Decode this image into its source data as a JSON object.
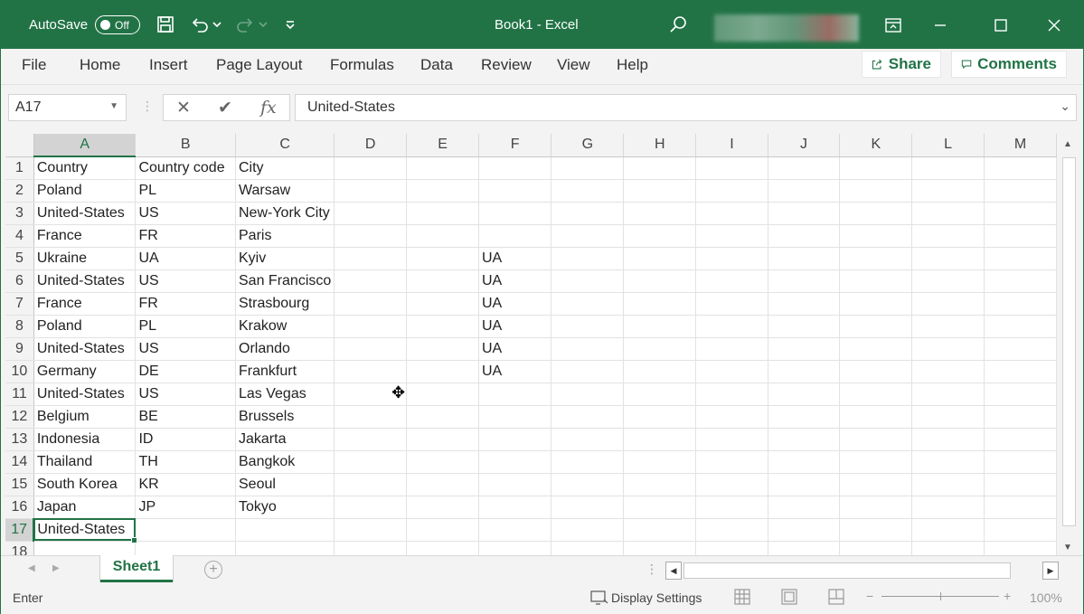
{
  "titlebar": {
    "autosave_label": "AutoSave",
    "autosave_state": "Off",
    "document_title": "Book1  -  Excel"
  },
  "ribbon": {
    "tabs": [
      "File",
      "Home",
      "Insert",
      "Page Layout",
      "Formulas",
      "Data",
      "Review",
      "View",
      "Help"
    ],
    "share_label": "Share",
    "comments_label": "Comments"
  },
  "formula_bar": {
    "name_box": "A17",
    "fx_label": "fx",
    "content": "United-States"
  },
  "grid": {
    "columns": [
      "A",
      "B",
      "C",
      "D",
      "E",
      "F",
      "G",
      "H",
      "I",
      "J",
      "K",
      "L",
      "M"
    ],
    "rows": [
      {
        "num": "1",
        "cells": [
          "Country",
          "Country code",
          "City",
          "",
          "",
          "",
          "",
          "",
          "",
          "",
          "",
          "",
          ""
        ]
      },
      {
        "num": "2",
        "cells": [
          "Poland",
          "PL",
          "Warsaw",
          "",
          "",
          "",
          "",
          "",
          "",
          "",
          "",
          "",
          ""
        ]
      },
      {
        "num": "3",
        "cells": [
          "United-States",
          "US",
          "New-York City",
          "",
          "",
          "",
          "",
          "",
          "",
          "",
          "",
          "",
          ""
        ]
      },
      {
        "num": "4",
        "cells": [
          "France",
          "FR",
          "Paris",
          "",
          "",
          "",
          "",
          "",
          "",
          "",
          "",
          "",
          ""
        ]
      },
      {
        "num": "5",
        "cells": [
          "Ukraine",
          "UA",
          "Kyiv",
          "",
          "",
          "UA",
          "",
          "",
          "",
          "",
          "",
          "",
          ""
        ]
      },
      {
        "num": "6",
        "cells": [
          "United-States",
          "US",
          "San Francisco",
          "",
          "",
          "UA",
          "",
          "",
          "",
          "",
          "",
          "",
          ""
        ]
      },
      {
        "num": "7",
        "cells": [
          "France",
          "FR",
          "Strasbourg",
          "",
          "",
          "UA",
          "",
          "",
          "",
          "",
          "",
          "",
          ""
        ]
      },
      {
        "num": "8",
        "cells": [
          "Poland",
          "PL",
          "Krakow",
          "",
          "",
          "UA",
          "",
          "",
          "",
          "",
          "",
          "",
          ""
        ]
      },
      {
        "num": "9",
        "cells": [
          "United-States",
          "US",
          "Orlando",
          "",
          "",
          "UA",
          "",
          "",
          "",
          "",
          "",
          "",
          ""
        ]
      },
      {
        "num": "10",
        "cells": [
          "Germany",
          "DE",
          "Frankfurt",
          "",
          "",
          "UA",
          "",
          "",
          "",
          "",
          "",
          "",
          ""
        ]
      },
      {
        "num": "11",
        "cells": [
          "United-States",
          "US",
          "Las Vegas",
          "",
          "",
          "",
          "",
          "",
          "",
          "",
          "",
          "",
          ""
        ]
      },
      {
        "num": "12",
        "cells": [
          "Belgium",
          "BE",
          "Brussels",
          "",
          "",
          "",
          "",
          "",
          "",
          "",
          "",
          "",
          ""
        ]
      },
      {
        "num": "13",
        "cells": [
          "Indonesia",
          "ID",
          "Jakarta",
          "",
          "",
          "",
          "",
          "",
          "",
          "",
          "",
          "",
          ""
        ]
      },
      {
        "num": "14",
        "cells": [
          "Thailand",
          "TH",
          "Bangkok",
          "",
          "",
          "",
          "",
          "",
          "",
          "",
          "",
          "",
          ""
        ]
      },
      {
        "num": "15",
        "cells": [
          "South Korea",
          "KR",
          "Seoul",
          "",
          "",
          "",
          "",
          "",
          "",
          "",
          "",
          "",
          ""
        ]
      },
      {
        "num": "16",
        "cells": [
          "Japan",
          "JP",
          "Tokyo",
          "",
          "",
          "",
          "",
          "",
          "",
          "",
          "",
          "",
          ""
        ]
      },
      {
        "num": "17",
        "cells": [
          "United-States",
          "",
          "",
          "",
          "",
          "",
          "",
          "",
          "",
          "",
          "",
          "",
          ""
        ]
      },
      {
        "num": "18",
        "cells": [
          "",
          "",
          "",
          "",
          "",
          "",
          "",
          "",
          "",
          "",
          "",
          "",
          ""
        ]
      }
    ],
    "active_cell": "A17"
  },
  "sheets": {
    "tabs": [
      "Sheet1"
    ],
    "add_label": "+"
  },
  "statusbar": {
    "mode": "Enter",
    "display_settings": "Display Settings",
    "zoom": "100%"
  },
  "colors": {
    "accent": "#217346"
  }
}
